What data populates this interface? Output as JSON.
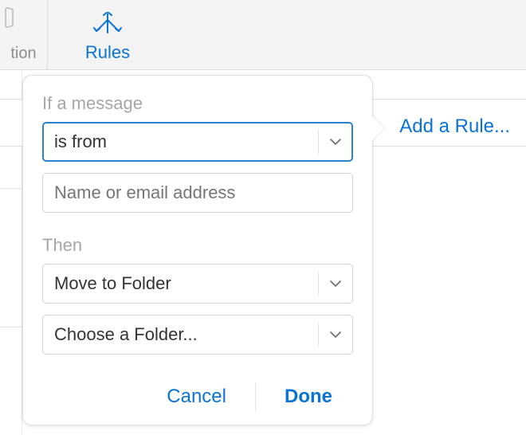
{
  "toolbar": {
    "truncated_label": "tion",
    "rules_label": "Rules"
  },
  "add_rule_link": "Add a Rule...",
  "popover": {
    "section_if": "If a message",
    "condition_value": "is from",
    "address_placeholder": "Name or email address",
    "section_then": "Then",
    "action_value": "Move to Folder",
    "folder_value": "Choose a Folder...",
    "cancel_label": "Cancel",
    "done_label": "Done"
  }
}
